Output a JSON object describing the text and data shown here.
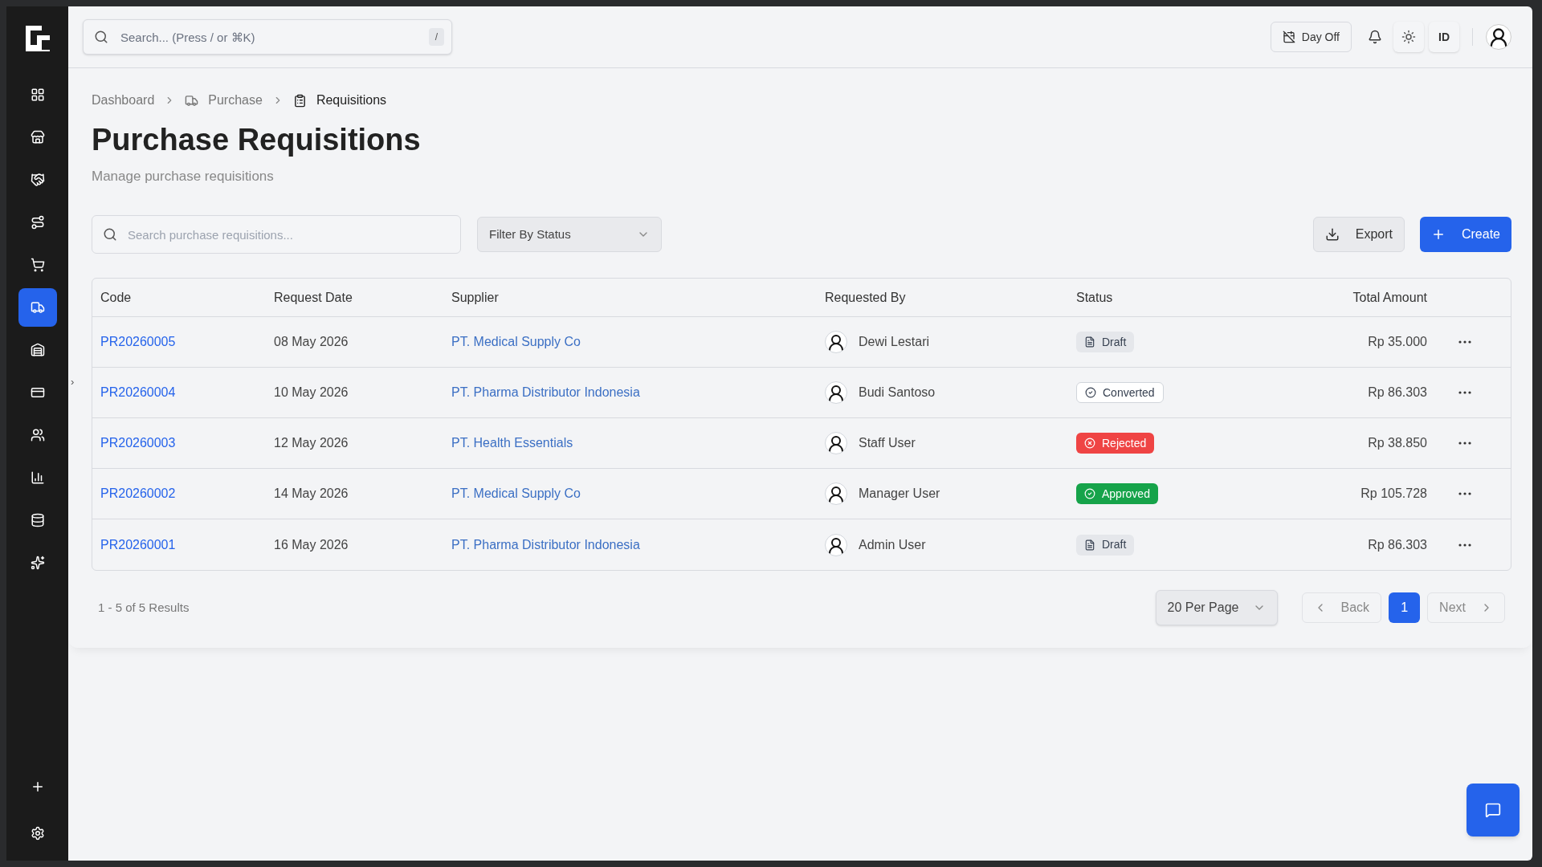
{
  "topbar": {
    "search": {
      "placeholder": "Search... (Press / or ⌘K)",
      "shortcut": "/"
    },
    "day_off": "Day Off",
    "language": "ID"
  },
  "sidebar": {
    "items": [
      {
        "selected": false
      },
      {
        "selected": false
      },
      {
        "selected": false
      },
      {
        "selected": false
      },
      {
        "selected": false
      },
      {
        "selected": true
      },
      {
        "selected": false
      },
      {
        "selected": false
      },
      {
        "selected": false
      },
      {
        "selected": false
      },
      {
        "selected": false
      },
      {
        "selected": false
      }
    ],
    "collapse": "›"
  },
  "breadcrumb": [
    {
      "label": "Dashboard"
    },
    {
      "label": "Purchase"
    },
    {
      "label": "Requisitions"
    }
  ],
  "page": {
    "title": "Purchase Requisitions",
    "subtitle": "Manage purchase requisitions"
  },
  "toolbar": {
    "search": {
      "placeholder": "Search purchase requisitions..."
    },
    "filter": "Filter By Status",
    "export": "Export",
    "create": "Create"
  },
  "table": {
    "columns": [
      "Code",
      "Request Date",
      "Supplier",
      "Requested By",
      "Status",
      "Total Amount"
    ],
    "rows": [
      {
        "code": "PR20260005",
        "date": "08 May 2026",
        "supplier": "PT. Medical Supply Co",
        "requested_by": "Dewi Lestari",
        "status": {
          "label": "Draft",
          "kind": "draft"
        },
        "total": "Rp 35.000"
      },
      {
        "code": "PR20260004",
        "date": "10 May 2026",
        "supplier": "PT. Pharma Distributor Indonesia",
        "requested_by": "Budi Santoso",
        "status": {
          "label": "Converted",
          "kind": "converted"
        },
        "total": "Rp 86.303"
      },
      {
        "code": "PR20260003",
        "date": "12 May 2026",
        "supplier": "PT. Health Essentials",
        "requested_by": "Staff User",
        "status": {
          "label": "Rejected",
          "kind": "rejected"
        },
        "total": "Rp 38.850"
      },
      {
        "code": "PR20260002",
        "date": "14 May 2026",
        "supplier": "PT. Medical Supply Co",
        "requested_by": "Manager User",
        "status": {
          "label": "Approved",
          "kind": "approved"
        },
        "total": "Rp 105.728"
      },
      {
        "code": "PR20260001",
        "date": "16 May 2026",
        "supplier": "PT. Pharma Distributor Indonesia",
        "requested_by": "Admin User",
        "status": {
          "label": "Draft",
          "kind": "draft"
        },
        "total": "Rp 86.303"
      }
    ]
  },
  "pagination": {
    "summary": "1 - 5 of 5 Results",
    "per_page": "20 Per Page",
    "back": "Back",
    "next": "Next",
    "pages": [
      {
        "label": "1",
        "selected": true
      }
    ]
  }
}
